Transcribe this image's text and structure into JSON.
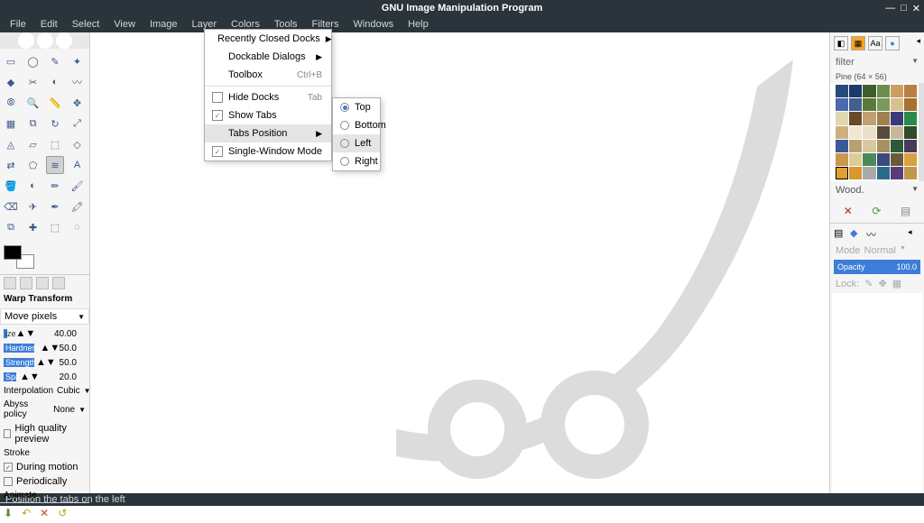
{
  "app": {
    "title": "GNU Image Manipulation Program"
  },
  "menu": {
    "items": [
      "File",
      "Edit",
      "Select",
      "View",
      "Image",
      "Layer",
      "Colors",
      "Tools",
      "Filters",
      "Windows",
      "Help"
    ]
  },
  "windows_menu": {
    "recently_closed": "Recently Closed Docks",
    "dockable": "Dockable Dialogs",
    "toolbox": "Toolbox",
    "toolbox_short": "Ctrl+B",
    "hide_docks": "Hide Docks",
    "hide_docks_short": "Tab",
    "show_tabs": "Show Tabs",
    "tabs_position": "Tabs Position",
    "single_window": "Single-Window Mode"
  },
  "tabs_pos": {
    "top": "Top",
    "bottom": "Bottom",
    "left": "Left",
    "right": "Right"
  },
  "tool_options": {
    "title": "Warp Transform",
    "mode_label": "Move pixels",
    "size_label": "ize",
    "size_val": "40.00",
    "hardness_label": "Hardness",
    "hardness_val": "50.0",
    "strength_label": "Strength",
    "strength_val": "50.0",
    "spacing_label": "Spa",
    "spacing_val": "20.0",
    "interp_label": "Interpolation",
    "interp_val": "Cubic",
    "abyss_label": "Abyss policy",
    "abyss_val": "None",
    "hq_preview": "High quality preview",
    "stroke": "Stroke",
    "during_motion": "During motion",
    "periodically": "Periodically",
    "animate": "Animate"
  },
  "patterns": {
    "filter_label": "filter",
    "dim_label": "Pine (64 × 56)",
    "selected_name": "Wood."
  },
  "layers": {
    "mode_l": "Mode",
    "mode_v": "Normal",
    "opacity_l": "Opacity",
    "opacity_v": "100.0",
    "lock_l": "Lock:"
  },
  "status": {
    "text": "Position the tabs on the left"
  },
  "pattern_colors": [
    "#2a4a7a",
    "#1a3a6a",
    "#3e5e2e",
    "#6e8e4e",
    "#caa060",
    "#b88040",
    "#4a6ab0",
    "#406090",
    "#5a7a3a",
    "#7a9a5a",
    "#d8c090",
    "#a87030",
    "#e0d8b0",
    "#6a4a2a",
    "#c0a070",
    "#a08050",
    "#3a3a7a",
    "#2a8a4a",
    "#d0b080",
    "#f0e8d0",
    "#e8e0c8",
    "#5a4a3a",
    "#c8b898",
    "#304a2a",
    "#3a5a9a",
    "#b8a070",
    "#d8c8a0",
    "#a89060",
    "#2a5a3a",
    "#4a3a5a",
    "#c89850",
    "#dccc98",
    "#4a8a5a",
    "#3a4a7a",
    "#6a5a3a",
    "#d8a040",
    "#e0a030",
    "#d89830",
    "#aaaaaa",
    "#2a6a8a",
    "#5a3a7a",
    "#c09848"
  ]
}
